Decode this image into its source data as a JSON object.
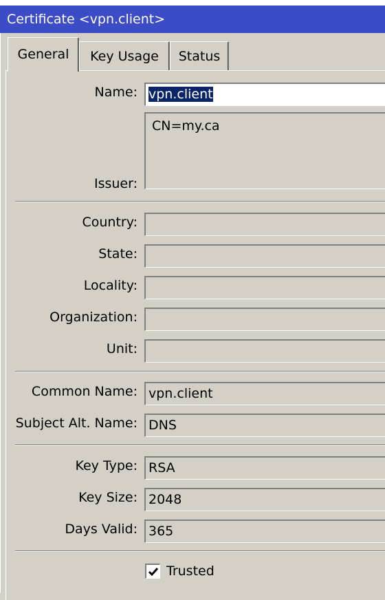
{
  "window": {
    "title": "Certificate <vpn.client>"
  },
  "tabs": [
    {
      "label": "General"
    },
    {
      "label": "Key Usage"
    },
    {
      "label": "Status"
    }
  ],
  "form": {
    "name": {
      "label": "Name:",
      "value": "vpn.client"
    },
    "issuer": {
      "label": "Issuer:",
      "value": "CN=my.ca"
    },
    "country": {
      "label": "Country:",
      "value": ""
    },
    "state": {
      "label": "State:",
      "value": ""
    },
    "locality": {
      "label": "Locality:",
      "value": ""
    },
    "organization": {
      "label": "Organization:",
      "value": ""
    },
    "unit": {
      "label": "Unit:",
      "value": ""
    },
    "common_name": {
      "label": "Common Name:",
      "value": "vpn.client"
    },
    "subject_alt_name": {
      "label": "Subject Alt. Name:",
      "value": "DNS"
    },
    "key_type": {
      "label": "Key Type:",
      "value": "RSA"
    },
    "key_size": {
      "label": "Key Size:",
      "value": "2048"
    },
    "days_valid": {
      "label": "Days Valid:",
      "value": "365"
    },
    "trusted": {
      "label": "Trusted",
      "checked": true
    }
  },
  "colors": {
    "titlebar": "#3b4cc6",
    "window_bg": "#d4d0c8",
    "selection": "#0a246a"
  },
  "icons": {
    "trusted_check": "checkmark-icon"
  }
}
